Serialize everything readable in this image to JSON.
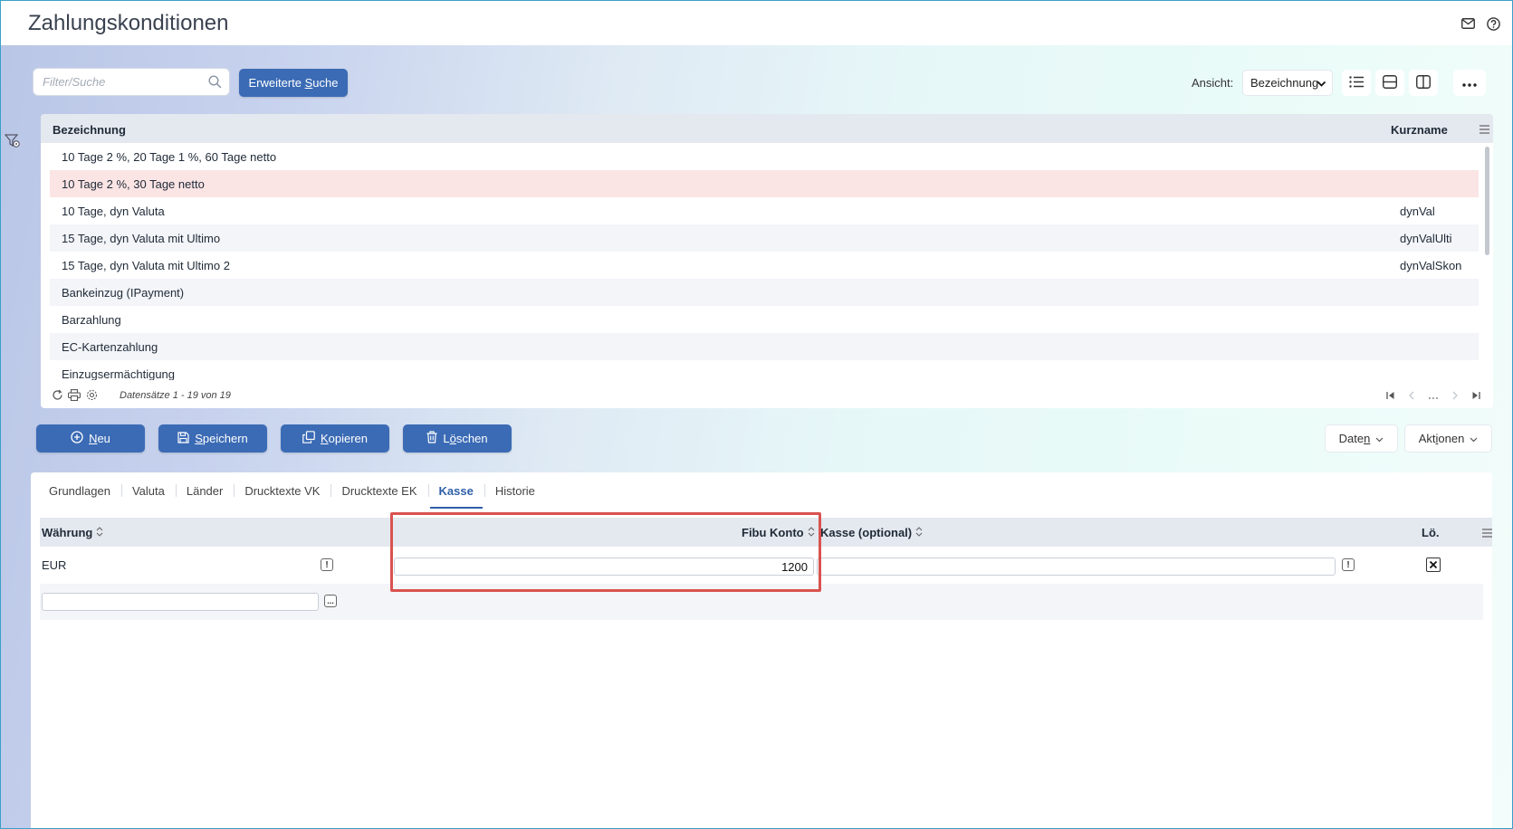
{
  "app": {
    "title": "Zahlungskonditionen"
  },
  "toolbar": {
    "search_placeholder": "Filter/Suche",
    "extended_search": {
      "pre": "Erweiterte ",
      "ul": "S",
      "post": "uche"
    },
    "view_label": "Ansicht:",
    "view_value": "Bezeichnung"
  },
  "grid": {
    "columns": [
      "Bezeichnung",
      "Kurzname"
    ],
    "rows": [
      {
        "name": "10 Tage 2 %, 20 Tage 1 %, 60 Tage netto",
        "short": ""
      },
      {
        "name": "10 Tage 2 %, 30 Tage netto",
        "short": ""
      },
      {
        "name": "10 Tage, dyn Valuta",
        "short": "dynVal"
      },
      {
        "name": "15 Tage, dyn Valuta mit Ultimo",
        "short": "dynValUlti"
      },
      {
        "name": "15 Tage, dyn Valuta mit Ultimo 2",
        "short": "dynValSkon"
      },
      {
        "name": "Bankeinzug (IPayment)",
        "short": ""
      },
      {
        "name": "Barzahlung",
        "short": ""
      },
      {
        "name": "EC-Kartenzahlung",
        "short": ""
      },
      {
        "name": "Einzugsermächtigung",
        "short": ""
      }
    ],
    "footer_info": "Datensätze 1 - 19 von 19"
  },
  "actions": {
    "new": {
      "ul": "N",
      "post": "eu"
    },
    "save": {
      "ul": "S",
      "post": "peichern"
    },
    "copy": {
      "ul": "K",
      "post": "opieren"
    },
    "delete": {
      "pre": "L",
      "ul": "ö",
      "post": "schen"
    },
    "data": {
      "pre": "Date",
      "ul": "n",
      "post": ""
    },
    "actions": {
      "pre": "Akt",
      "ul": "i",
      "post": "onen"
    }
  },
  "tabs": [
    {
      "label": "Grundlagen",
      "active": false
    },
    {
      "label": "Valuta",
      "active": false
    },
    {
      "label": "Länder",
      "active": false
    },
    {
      "label": "Drucktexte VK",
      "active": false
    },
    {
      "label": "Drucktexte EK",
      "active": false
    },
    {
      "label": "Kasse",
      "active": true
    },
    {
      "label": "Historie",
      "active": false
    }
  ],
  "detail": {
    "columns": {
      "currency": "Währung",
      "fibu": "Fibu Konto",
      "kasse": "Kasse (optional)",
      "del": "Lö."
    },
    "rows": [
      {
        "currency": "EUR",
        "fibu": "1200",
        "kasse": ""
      }
    ],
    "new_row_button": "..."
  },
  "colors": {
    "primary": "#3b6bb5",
    "selected_row": "#fbe4e4",
    "highlight": "#d9534f"
  }
}
